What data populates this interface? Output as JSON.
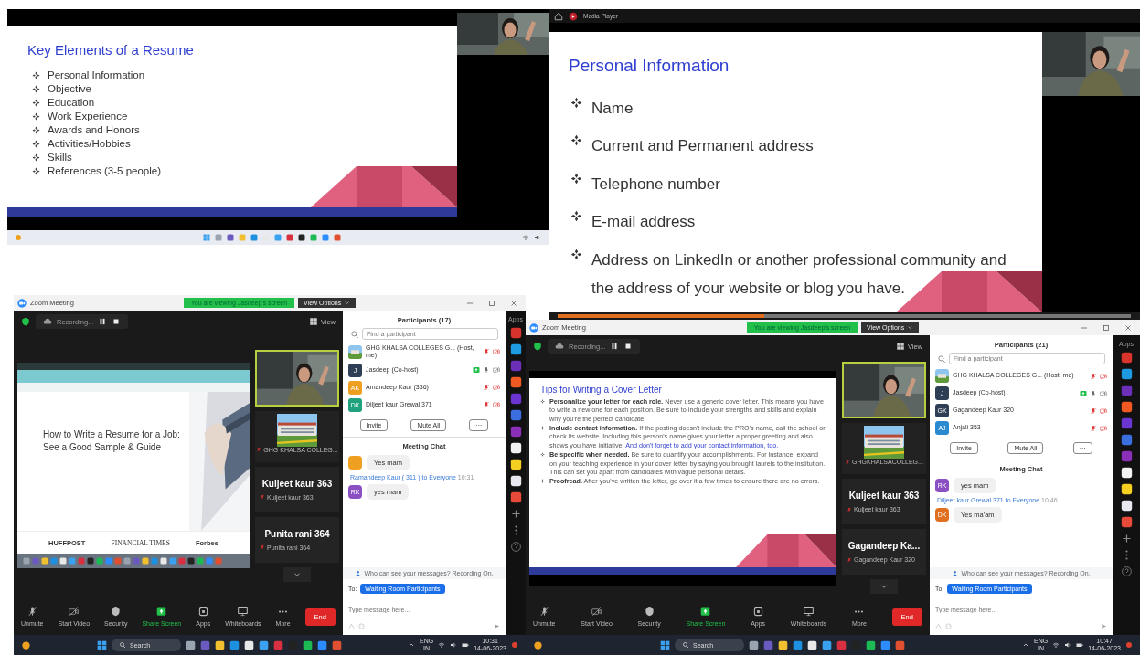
{
  "top_left": {
    "slide": {
      "title": "Key Elements of a Resume",
      "bullets": [
        "Personal Information",
        "Objective",
        "Education",
        "Work Experience",
        "Awards and Honors",
        "Activities/Hobbies",
        "Skills",
        "References (3-5 people)"
      ]
    }
  },
  "top_right": {
    "window": {
      "title": "Media Player"
    },
    "slide": {
      "title": "Personal Information",
      "bullets": [
        "Name",
        "Current and Permanent address",
        "Telephone number",
        "E-mail address",
        "Address on LinkedIn or another professional community and the address of your website or blog you have."
      ]
    },
    "progress": {
      "level": 0.36
    }
  },
  "meetings": [
    {
      "window": {
        "title": "Zoom Meeting"
      },
      "banner": "You are viewing Jasdeep's screen",
      "view_options": "View Options",
      "recording": "Recording...",
      "view": "View",
      "share": {
        "kind": "webpage",
        "headline": "How to Write a Resume for a Job: See a Good Sample & Guide",
        "logos": [
          "HUFFPOST",
          "FINANCIAL TIMES",
          "Forbes"
        ]
      },
      "tiles": [
        {
          "kind": "video"
        },
        {
          "kind": "picture",
          "label": "GHG KHALSA COLLEG..."
        },
        {
          "kind": "name",
          "name": "Kuljeet kaur 363",
          "label": "Kuljeet kaur 363"
        },
        {
          "kind": "name",
          "name": "Punita rani 364",
          "label": "Punita rani 364"
        }
      ],
      "toolbar": [
        {
          "kind": "mic",
          "label": "Unmute"
        },
        {
          "kind": "camera",
          "label": "Start Video"
        },
        {
          "kind": "shield",
          "label": "Security"
        },
        {
          "kind": "share",
          "label": "Share Screen"
        },
        {
          "kind": "apps",
          "label": "Apps"
        },
        {
          "kind": "board",
          "label": "Whiteboards"
        },
        {
          "kind": "more",
          "label": "More"
        }
      ],
      "end": "End",
      "participants": {
        "title": "Participants (17)",
        "placeholder": "Find a participant",
        "rows": [
          {
            "kind": "picture",
            "name": "GHG KHALSA COLLEGES G...",
            "role": "(Host, me)",
            "muted": true,
            "sharing": false
          },
          {
            "kind": "initials",
            "initials": "J",
            "color": "#2e3f55",
            "name": "Jasdeep (Co-host)",
            "muted": false,
            "sharing": true
          },
          {
            "kind": "initials",
            "initials": "AK",
            "color": "#f0a020",
            "name": "Amandeep Kaur (336)",
            "muted": true,
            "sharing": false
          },
          {
            "kind": "initials",
            "initials": "DK",
            "color": "#1fa37f",
            "name": "Diljeet kaur Grewal 371",
            "muted": true,
            "sharing": false
          }
        ],
        "buttons": [
          "Invite",
          "Mute All",
          "···"
        ]
      },
      "chat": {
        "title": "Meeting Chat",
        "messages": [
          {
            "color": "#f0a020",
            "text": "Yes mam"
          },
          {
            "sender": "Ramandeep Kaur ( 311 ) to Everyone",
            "time": "10:31",
            "initials": "RK",
            "color": "#8a4fc0",
            "text": "yes mam"
          }
        ],
        "notice": "Who can see your messages? Recording On.",
        "to_label": "To:",
        "recipient": "Waiting Room Participants",
        "placeholder": "Type message here..."
      },
      "apps": {
        "title": "Apps",
        "items": [
          {
            "color": "#d9342b"
          },
          {
            "color": "#1e9be0"
          },
          {
            "color": "#6b2fb8"
          },
          {
            "color": "#f05a22"
          },
          {
            "color": "#6a35d0"
          },
          {
            "color": "#3b6fe0"
          },
          {
            "color": "#8a2fb8"
          },
          {
            "color": "#f2f2f2"
          },
          {
            "color": "#f5d020"
          },
          {
            "color": "#e8e8f0"
          },
          {
            "color": "#e84a3a"
          }
        ]
      },
      "taskbar": {
        "search": "Search",
        "lang": "ENG",
        "region": "IN",
        "time": "10:31",
        "date": "14-06-2023"
      }
    },
    {
      "window": {
        "title": "Zoom Meeting"
      },
      "banner": "You are viewing Jasdeep's screen",
      "view_options": "View Options",
      "recording": "Recording...",
      "view": "View",
      "share": {
        "kind": "slide",
        "title": "Tips for Writing a Cover Letter",
        "bullets": [
          {
            "text": "**Personalize your letter for each role.** Never use a generic cover letter. This means you have to write a new one for each position. Be sure to include your strengths and skills and explain why you're the perfect candidate."
          },
          {
            "text": "**Include contact information.** If the posting doesn't include the PRO's name, call the school or check its website. Including this person's name gives your letter a proper greeting and also shows you have initiative.",
            "highlight": "And don't forget to add your contact information, too."
          },
          {
            "text": "**Be specific when needed.** Be sure to quantify your accomplishments. For instance, expand on your teaching experience in your cover letter by saying you brought laurels to the institution. This can set you apart from candidates with vague personal details."
          },
          {
            "text": "**Proofread.** After you've written the letter, go over it a few times to ensure there are no errors."
          }
        ]
      },
      "tiles": [
        {
          "kind": "video"
        },
        {
          "kind": "picture",
          "label": "GHGKHALSACOLLEG..."
        },
        {
          "kind": "name",
          "name": "Kuljeet kaur 363",
          "label": "Kuljeet kaur 363"
        },
        {
          "kind": "name",
          "name": "Gagandeep  Ka...",
          "label": "Gagandeep Kaur 320"
        }
      ],
      "toolbar": [
        {
          "kind": "mic",
          "label": "Unmute"
        },
        {
          "kind": "camera",
          "label": "Start Video"
        },
        {
          "kind": "shield",
          "label": "Security"
        },
        {
          "kind": "share",
          "label": "Share Screen"
        },
        {
          "kind": "apps",
          "label": "Apps"
        },
        {
          "kind": "board",
          "label": "Whiteboards"
        },
        {
          "kind": "more",
          "label": "More"
        }
      ],
      "end": "End",
      "participants": {
        "title": "Participants (21)",
        "placeholder": "Find a participant",
        "rows": [
          {
            "kind": "picture",
            "name": "GHG KHALSA COLLEGES G...",
            "role": "(Host, me)",
            "muted": true,
            "sharing": false
          },
          {
            "kind": "initials",
            "initials": "J",
            "color": "#2e3f55",
            "name": "Jasdeep (Co-host)",
            "muted": false,
            "sharing": true
          },
          {
            "kind": "initials",
            "initials": "GK",
            "color": "#2e3f55",
            "name": "Gagandeep Kaur 320",
            "muted": true,
            "sharing": false
          },
          {
            "kind": "initials",
            "initials": "AJ",
            "color": "#2a8ad0",
            "name": "Anjali 353",
            "muted": true,
            "sharing": false
          }
        ],
        "buttons": [
          "Invite",
          "Mute All",
          "···"
        ]
      },
      "chat": {
        "title": "Meeting Chat",
        "messages": [
          {
            "initials": "RK",
            "color": "#8a4fc0",
            "text": "yes mam"
          },
          {
            "sender": "Diljeet kaur Grewal 371 to Everyone",
            "time": "10:46",
            "initials": "DK",
            "color": "#e07020",
            "text": "Yes ma'am"
          }
        ],
        "notice": "Who can see your messages? Recording On.",
        "to_label": "To:",
        "recipient": "Waiting Room Participants",
        "placeholder": "Type message here..."
      },
      "apps": {
        "title": "Apps",
        "items": [
          {
            "color": "#d9342b"
          },
          {
            "color": "#1e9be0"
          },
          {
            "color": "#6b2fb8"
          },
          {
            "color": "#f05a22"
          },
          {
            "color": "#6a35d0"
          },
          {
            "color": "#3b6fe0"
          },
          {
            "color": "#8a2fb8"
          },
          {
            "color": "#f2f2f2"
          },
          {
            "color": "#f5d020"
          },
          {
            "color": "#e8e8f0"
          },
          {
            "color": "#e84a3a"
          }
        ]
      },
      "taskbar": {
        "search": "Search",
        "lang": "ENG",
        "region": "IN",
        "time": "10:47",
        "date": "14-06-2023"
      }
    }
  ]
}
